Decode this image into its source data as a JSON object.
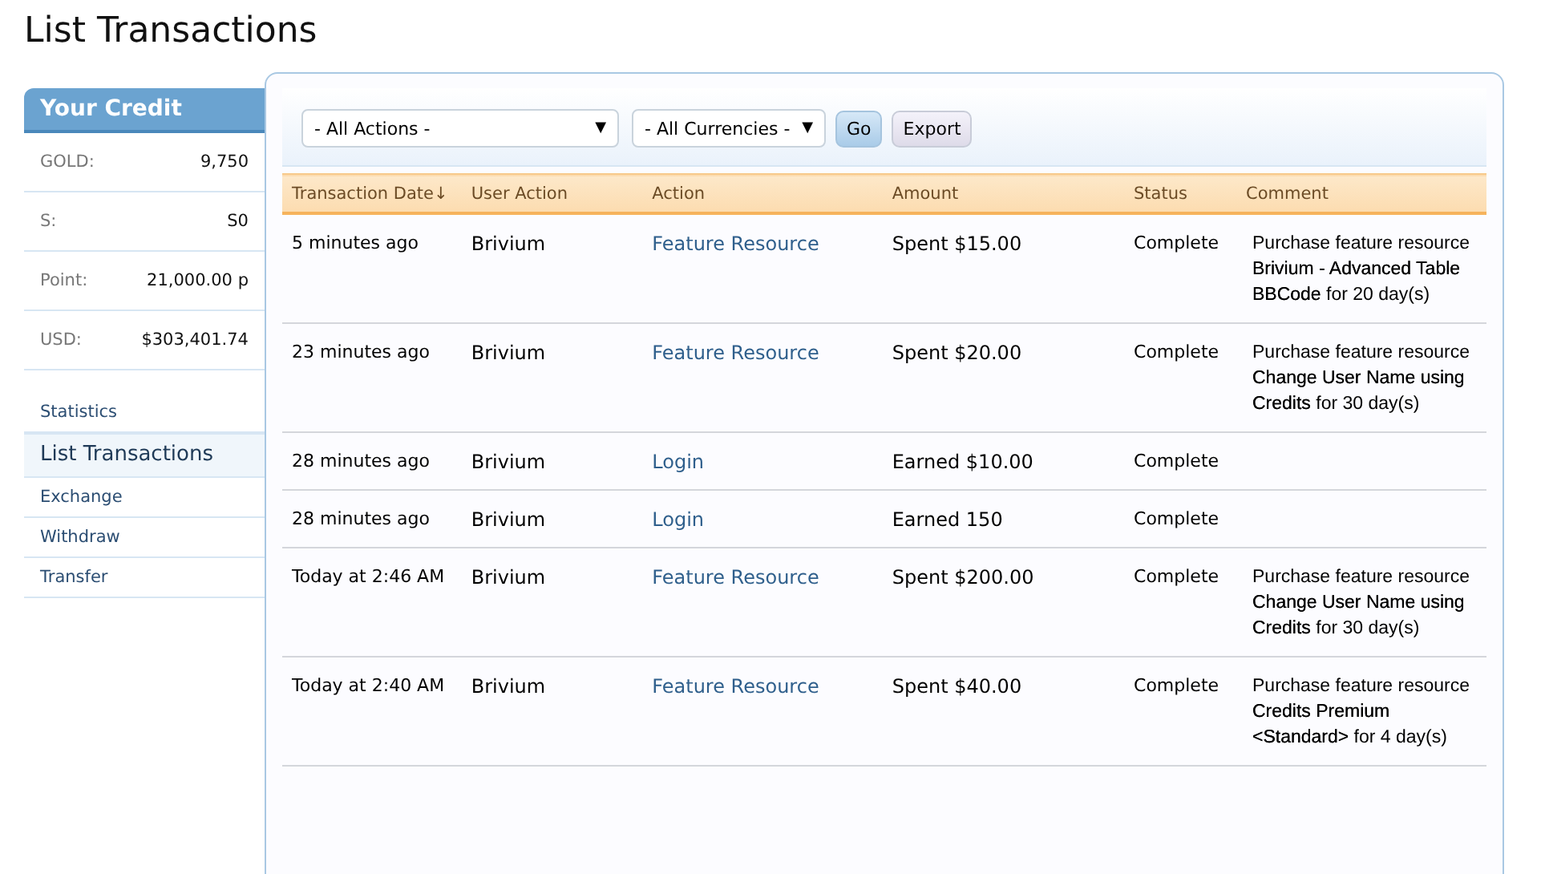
{
  "page_title": "List Transactions",
  "sidebar": {
    "title": "Your Credit",
    "credits": [
      {
        "label": "GOLD:",
        "value": "9,750"
      },
      {
        "label": "S:",
        "value": "S0"
      },
      {
        "label": "Point:",
        "value": "21,000.00 p"
      },
      {
        "label": "USD:",
        "value": "$303,401.74"
      }
    ],
    "nav": [
      {
        "label": "Statistics",
        "selected": false
      },
      {
        "label": "List Transactions",
        "selected": true
      },
      {
        "label": "Exchange",
        "selected": false
      },
      {
        "label": "Withdraw",
        "selected": false
      },
      {
        "label": "Transfer",
        "selected": false
      }
    ]
  },
  "filters": {
    "selects": [
      {
        "value": "- All Actions -",
        "caret": "▼"
      },
      {
        "value": "- All Currencies -",
        "caret": "▼"
      }
    ],
    "buttons": [
      {
        "label": "Go",
        "kind": "primary"
      },
      {
        "label": "Export",
        "kind": "secondary"
      }
    ]
  },
  "table": {
    "columns": [
      {
        "label": "Transaction Date",
        "sort": "↓"
      },
      {
        "label": "User Action"
      },
      {
        "label": "Action"
      },
      {
        "label": "Amount"
      },
      {
        "label": "Status"
      },
      {
        "label": "Comment"
      }
    ],
    "rows": [
      {
        "date": "5 minutes ago",
        "user": "Brivium",
        "action": "Feature Resource",
        "amount": "Spent $15.00",
        "status": "Complete",
        "comment": "Purchase feature resource **Brivium - Advanced Table BBCode** for 20 day(s)"
      },
      {
        "date": "23 minutes ago",
        "user": "Brivium",
        "action": "Feature Resource",
        "amount": "Spent $20.00",
        "status": "Complete",
        "comment": "Purchase feature resource **Change User Name using Credits** for 30 day(s)"
      },
      {
        "date": "28 minutes ago",
        "user": "Brivium",
        "action": "Login",
        "amount": "Earned $10.00",
        "status": "Complete",
        "comment": ""
      },
      {
        "date": "28 minutes ago",
        "user": "Brivium",
        "action": "Login",
        "amount": "Earned 150",
        "status": "Complete",
        "comment": ""
      },
      {
        "date": "Today at 2:46 AM",
        "user": "Brivium",
        "action": "Feature Resource",
        "amount": "Spent $200.00",
        "status": "Complete",
        "comment": "Purchase feature resource **Change User Name using Credits** for 30 day(s)"
      },
      {
        "date": "Today at 2:40 AM",
        "user": "Brivium",
        "action": "Feature Resource",
        "amount": "Spent $40.00",
        "status": "Complete",
        "comment": "Purchase feature resource **Credits Premium <Standard>** for 4 day(s)"
      }
    ]
  }
}
